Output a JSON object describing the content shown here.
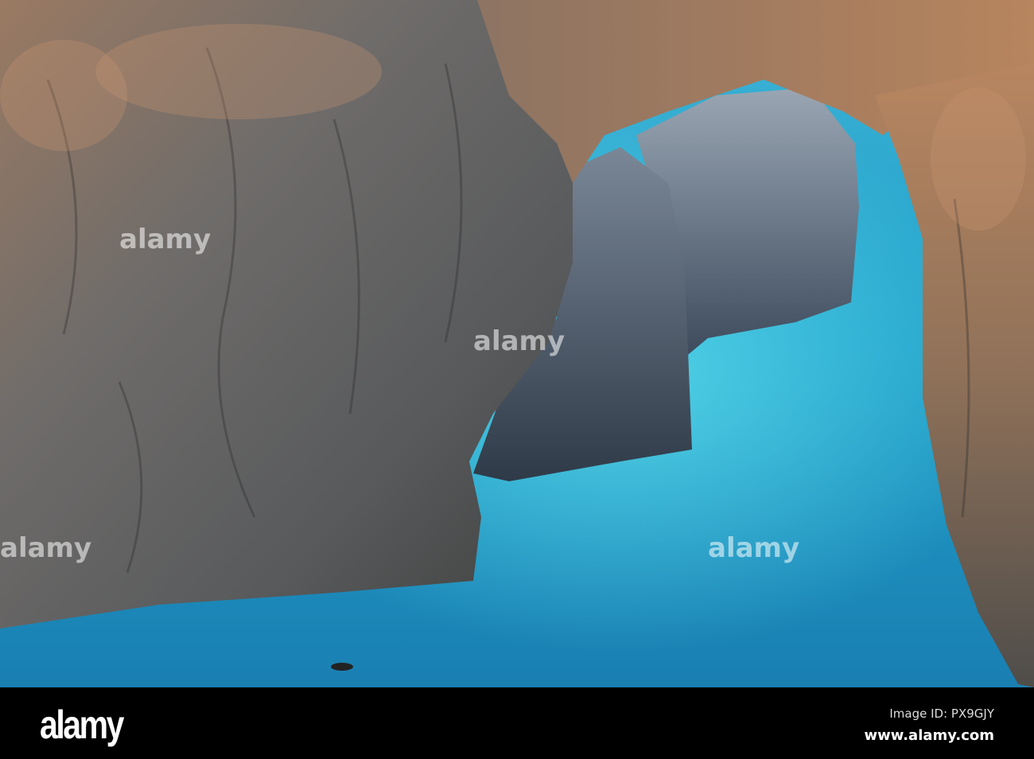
{
  "photo": {
    "subject": "sea-arch-cliffs"
  },
  "watermark": {
    "text": "alamy"
  },
  "footer": {
    "logo": "alamy",
    "image_id": "Image ID: PX9GJY",
    "website": "www.alamy.com"
  }
}
